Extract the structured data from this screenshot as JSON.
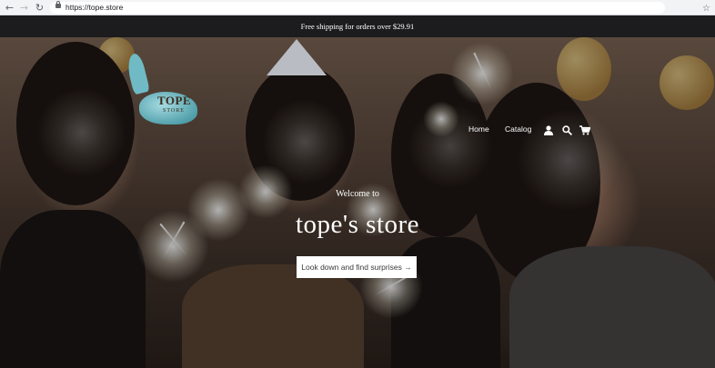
{
  "browser": {
    "back_icon": "arrow-left-icon",
    "forward_icon": "arrow-right-icon",
    "reload_icon": "reload-icon",
    "lock_icon": "lock-icon",
    "url": "https://tope.store",
    "bookmark_icon": "star-icon"
  },
  "announcement": {
    "text": "Free shipping for orders over $29.91"
  },
  "header": {
    "logo": {
      "title": "TOPE",
      "subtitle": "STORE"
    },
    "nav": [
      {
        "label": "Home"
      },
      {
        "label": "Catalog"
      }
    ],
    "icons": [
      "account-icon",
      "search-icon",
      "cart-icon"
    ]
  },
  "hero": {
    "welcome": "Welcome to",
    "title": "tope's store",
    "cta_label": "Look down and find surprises →"
  },
  "colors": {
    "announcement_bg": "#1c1b1d",
    "text_light": "#ffffff",
    "cta_bg": "#ffffff"
  }
}
